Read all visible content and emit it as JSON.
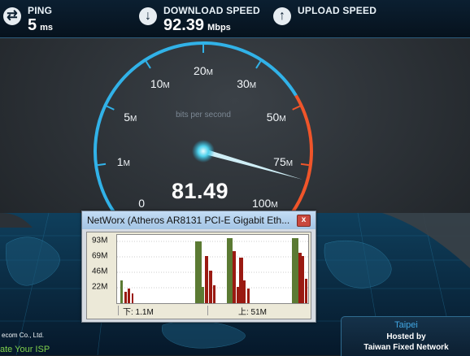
{
  "metrics": {
    "ping": {
      "label": "PING",
      "value": "5",
      "unit": "ms",
      "icon": "swap-arrows-icon"
    },
    "download": {
      "label": "DOWNLOAD SPEED",
      "value": "92.39",
      "unit": "Mbps",
      "icon": "download-arrow-icon"
    },
    "upload": {
      "label": "UPLOAD SPEED",
      "value": "",
      "unit": "",
      "icon": "upload-arrow-icon"
    }
  },
  "gauge": {
    "caption": "bits per second",
    "readout": "81.49",
    "needle_value_mbps": 81.49,
    "ticks": [
      {
        "num": "0",
        "unit": "",
        "value": 0
      },
      {
        "num": "1",
        "unit": "M",
        "value": 1
      },
      {
        "num": "5",
        "unit": "M",
        "value": 5
      },
      {
        "num": "10",
        "unit": "M",
        "value": 10
      },
      {
        "num": "20",
        "unit": "M",
        "value": 20
      },
      {
        "num": "30",
        "unit": "M",
        "value": 30
      },
      {
        "num": "50",
        "unit": "M",
        "value": 50
      },
      {
        "num": "75",
        "unit": "M",
        "value": 75
      },
      {
        "num": "100",
        "unit": "M",
        "value": 100
      }
    ],
    "colors": {
      "arc": "#31b2e8",
      "arc_high": "#f0552a",
      "needle": "#cfeef6"
    }
  },
  "networx": {
    "title": "NetWorx (Atheros AR8131 PCI-E Gigabit Eth...",
    "close_label": "x",
    "y_labels": [
      "93M",
      "69M",
      "46M",
      "22M"
    ],
    "down_label": "下: 1.1M",
    "up_label": "上: 51M",
    "colors": {
      "download": "#5b7a33",
      "upload": "#9a1a12"
    }
  },
  "isp": {
    "company": "ecom Co., Ltd.",
    "rate": "ate Your ISP"
  },
  "server": {
    "city": "Taipei",
    "hosted_by": "Hosted by",
    "name": "Taiwan Fixed Network"
  }
}
